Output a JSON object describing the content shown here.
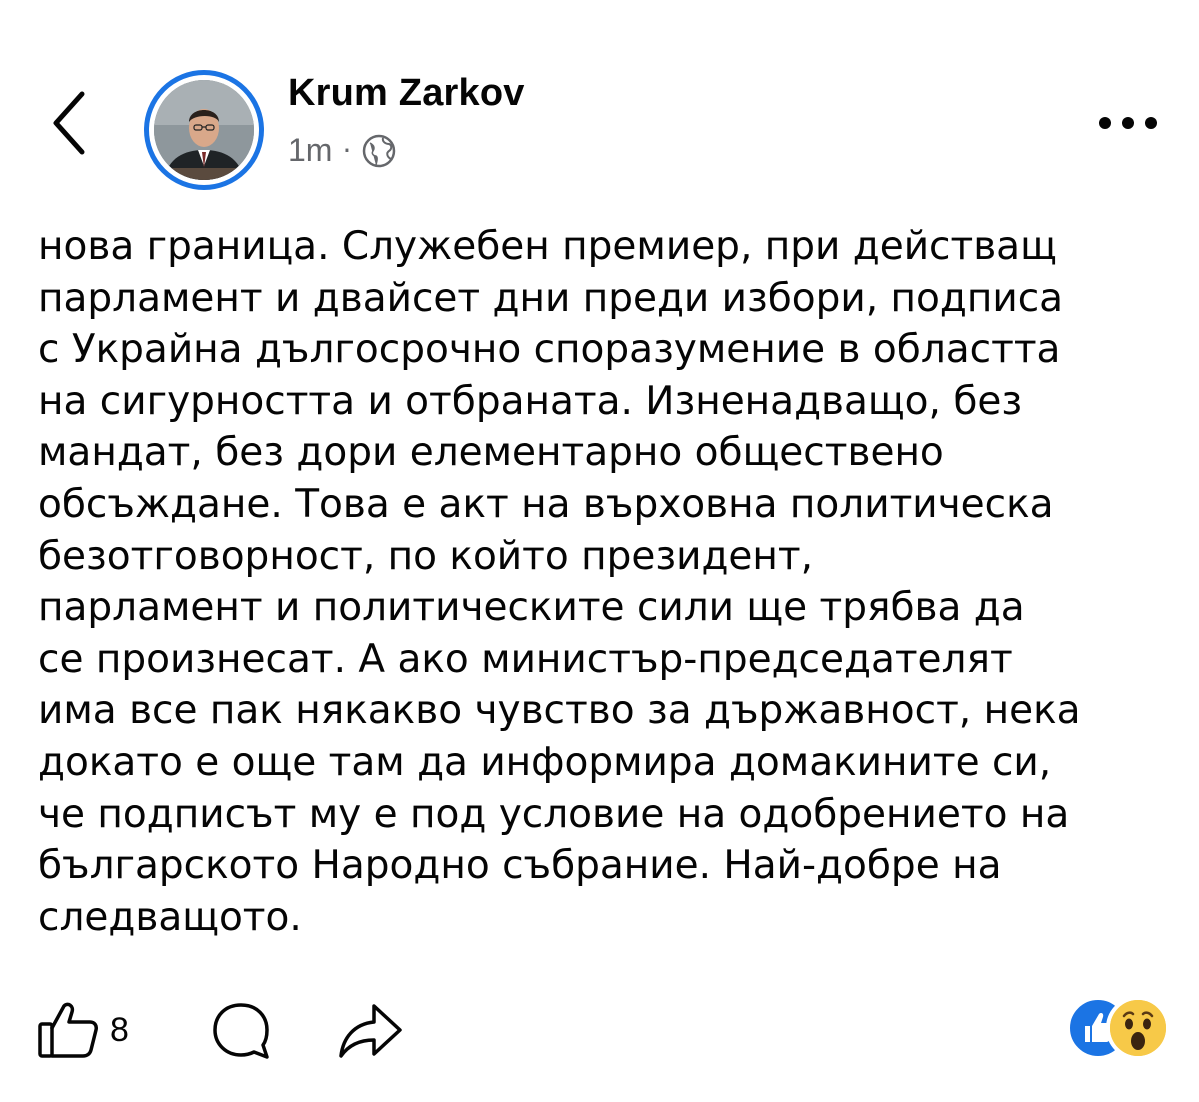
{
  "header": {
    "author_name": "Krum Zarkov",
    "time": "1m",
    "separator": "·",
    "icons": {
      "back": "chevron-left-icon",
      "audience": "globe-icon",
      "more": "more-dots-icon"
    }
  },
  "post": {
    "text": "нова граница. Служебен премиер, при действащ\nпарламент и двайсет дни преди избори, подписа\nс Украйна дългосрочно споразумение в областта\nна сигурността и отбраната. Изненадващо, без\nмандат, без дори елементарно обществено\nобсъждане. Това е акт на върховна политическа\nбезотговорност, по който президент,\nпарламент и политическите сили ще трябва да\nсе произнесат. А ако министър-председателят\nима все пак някакво чувство за държавност, нека\nдокато е още там да информира домакините си,\nче подписът му е под условие на одобрението на\nбългарското Народно събрание. Най-добре на\nследващото."
  },
  "actions": {
    "like_count": "8",
    "icons": {
      "like": "thumbs-up-icon",
      "comment": "comment-icon",
      "share": "share-icon"
    }
  },
  "reactions": [
    {
      "type": "like",
      "icon": "like-reaction-icon",
      "color": "#1b74e4"
    },
    {
      "type": "wow",
      "icon": "wow-reaction-icon",
      "color": "#f7c948"
    }
  ],
  "colors": {
    "accent": "#1b74e4",
    "secondary_text": "#65676b",
    "text": "#050505"
  }
}
